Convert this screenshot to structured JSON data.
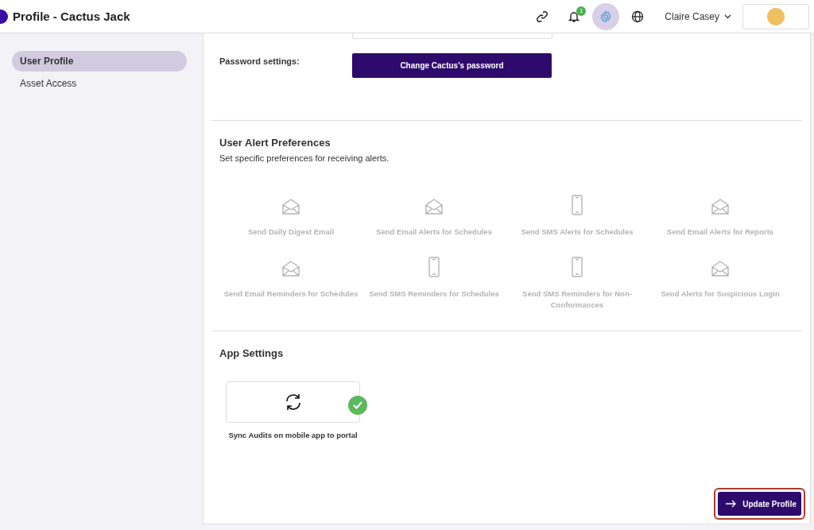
{
  "header": {
    "title": "Profile - Cactus Jack",
    "notification_count": "1",
    "settings_active": true,
    "user_name": "Claire Casey"
  },
  "sidebar": {
    "items": [
      {
        "label": "User Profile",
        "selected": true
      },
      {
        "label": "Asset Access",
        "selected": false
      }
    ]
  },
  "password": {
    "label": "Password settings:",
    "button": "Change Cactus's password"
  },
  "alerts": {
    "title": "User Alert Preferences",
    "subtitle": "Set specific preferences for receiving alerts.",
    "items": [
      {
        "kind": "email",
        "label": "Send Daily Digest Email",
        "enabled": false
      },
      {
        "kind": "email",
        "label": "Send Email Alerts for Schedules",
        "enabled": false
      },
      {
        "kind": "phone",
        "label": "Send SMS Alerts for Schedules",
        "enabled": false
      },
      {
        "kind": "email",
        "label": "Send Email Alerts for Reports",
        "enabled": false
      },
      {
        "kind": "email",
        "label": "Send Email Reminders for Schedules",
        "enabled": false
      },
      {
        "kind": "phone",
        "label": "Send SMS Reminders for Schedules",
        "enabled": false
      },
      {
        "kind": "phone",
        "label": "Send SMS Reminders for Non-Conformances",
        "enabled": false
      },
      {
        "kind": "email",
        "label": "Send Alerts for Suspicious Login",
        "enabled": false
      }
    ]
  },
  "app_settings": {
    "title": "App Settings",
    "items": [
      {
        "kind": "sync",
        "label": "Sync Audits on mobile app to portal",
        "checked": true
      }
    ]
  },
  "update_button": {
    "label": "Update Profile",
    "highlighted": true
  }
}
